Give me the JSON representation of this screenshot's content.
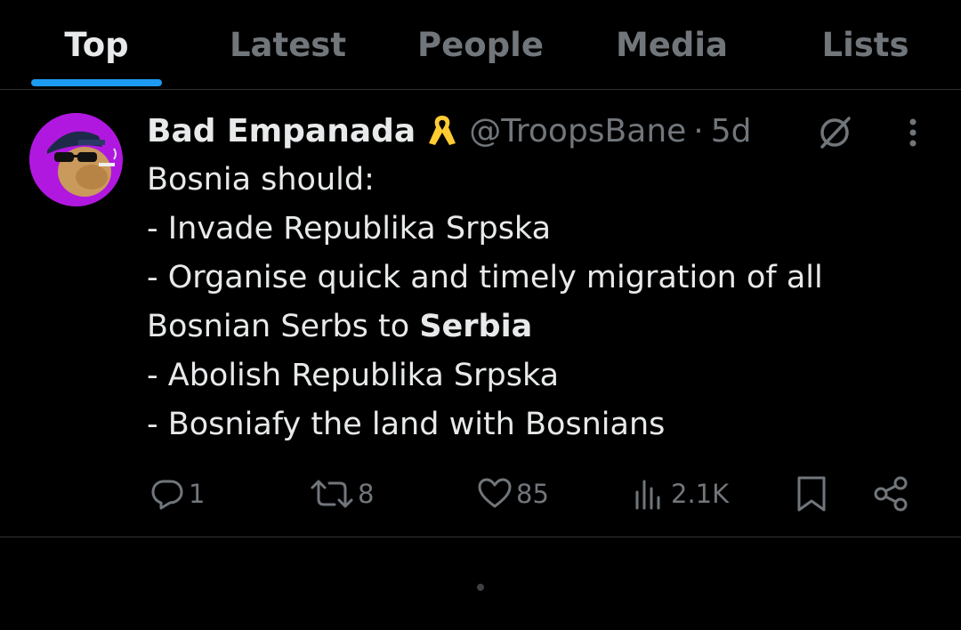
{
  "tabs": [
    {
      "label": "Top",
      "active": true
    },
    {
      "label": "Latest",
      "active": false
    },
    {
      "label": "People",
      "active": false
    },
    {
      "label": "Media",
      "active": false
    },
    {
      "label": "Lists",
      "active": false
    }
  ],
  "colors": {
    "background": "#000000",
    "accent": "#1d9bf0",
    "text": "#e7e9ea",
    "muted": "#71767b",
    "ribbon": "#ffcc33",
    "avatar_bg": "#b018e0"
  },
  "tweet": {
    "author_name": "Bad Empanada",
    "author_badge_icon": "yellow-ribbon-icon",
    "handle": "@TroopsBane",
    "separator": "·",
    "time": "5d",
    "text_lines": [
      "Bosnia should:",
      "- Invade Republika Srpska",
      "- Organise quick and timely migration of all"
    ],
    "line4_prefix": "Bosnian Serbs to ",
    "line4_bold": "Serbia",
    "text_lines_after": [
      "- Abolish Republika Srpska",
      "- Bosniafy the land with Bosnians"
    ],
    "actions": {
      "replies": "1",
      "reposts": "8",
      "likes": "85",
      "views": "2.1K"
    }
  }
}
